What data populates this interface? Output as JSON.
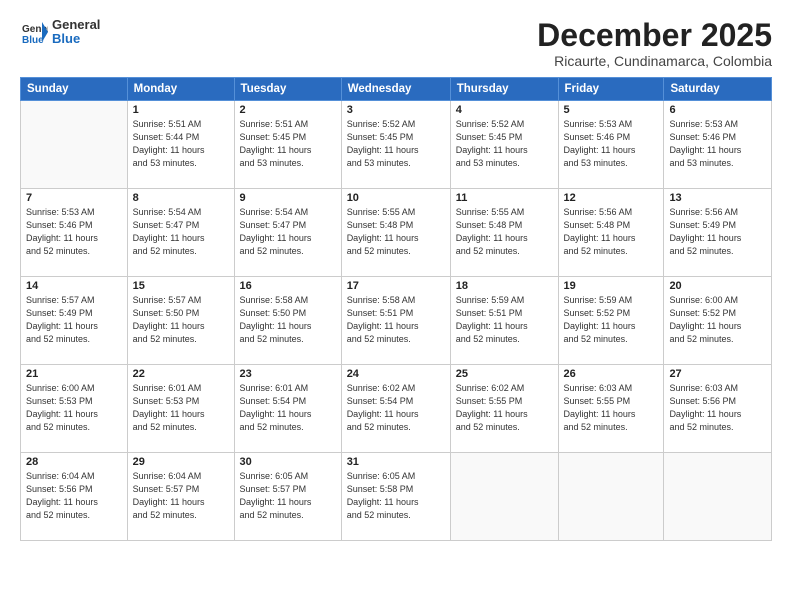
{
  "header": {
    "logo_general": "General",
    "logo_blue": "Blue",
    "main_title": "December 2025",
    "subtitle": "Ricaurte, Cundinamarca, Colombia"
  },
  "weekdays": [
    "Sunday",
    "Monday",
    "Tuesday",
    "Wednesday",
    "Thursday",
    "Friday",
    "Saturday"
  ],
  "weeks": [
    [
      {
        "day": "",
        "info": ""
      },
      {
        "day": "1",
        "info": "Sunrise: 5:51 AM\nSunset: 5:44 PM\nDaylight: 11 hours\nand 53 minutes."
      },
      {
        "day": "2",
        "info": "Sunrise: 5:51 AM\nSunset: 5:45 PM\nDaylight: 11 hours\nand 53 minutes."
      },
      {
        "day": "3",
        "info": "Sunrise: 5:52 AM\nSunset: 5:45 PM\nDaylight: 11 hours\nand 53 minutes."
      },
      {
        "day": "4",
        "info": "Sunrise: 5:52 AM\nSunset: 5:45 PM\nDaylight: 11 hours\nand 53 minutes."
      },
      {
        "day": "5",
        "info": "Sunrise: 5:53 AM\nSunset: 5:46 PM\nDaylight: 11 hours\nand 53 minutes."
      },
      {
        "day": "6",
        "info": "Sunrise: 5:53 AM\nSunset: 5:46 PM\nDaylight: 11 hours\nand 53 minutes."
      }
    ],
    [
      {
        "day": "7",
        "info": "Sunrise: 5:53 AM\nSunset: 5:46 PM\nDaylight: 11 hours\nand 52 minutes."
      },
      {
        "day": "8",
        "info": "Sunrise: 5:54 AM\nSunset: 5:47 PM\nDaylight: 11 hours\nand 52 minutes."
      },
      {
        "day": "9",
        "info": "Sunrise: 5:54 AM\nSunset: 5:47 PM\nDaylight: 11 hours\nand 52 minutes."
      },
      {
        "day": "10",
        "info": "Sunrise: 5:55 AM\nSunset: 5:48 PM\nDaylight: 11 hours\nand 52 minutes."
      },
      {
        "day": "11",
        "info": "Sunrise: 5:55 AM\nSunset: 5:48 PM\nDaylight: 11 hours\nand 52 minutes."
      },
      {
        "day": "12",
        "info": "Sunrise: 5:56 AM\nSunset: 5:48 PM\nDaylight: 11 hours\nand 52 minutes."
      },
      {
        "day": "13",
        "info": "Sunrise: 5:56 AM\nSunset: 5:49 PM\nDaylight: 11 hours\nand 52 minutes."
      }
    ],
    [
      {
        "day": "14",
        "info": "Sunrise: 5:57 AM\nSunset: 5:49 PM\nDaylight: 11 hours\nand 52 minutes."
      },
      {
        "day": "15",
        "info": "Sunrise: 5:57 AM\nSunset: 5:50 PM\nDaylight: 11 hours\nand 52 minutes."
      },
      {
        "day": "16",
        "info": "Sunrise: 5:58 AM\nSunset: 5:50 PM\nDaylight: 11 hours\nand 52 minutes."
      },
      {
        "day": "17",
        "info": "Sunrise: 5:58 AM\nSunset: 5:51 PM\nDaylight: 11 hours\nand 52 minutes."
      },
      {
        "day": "18",
        "info": "Sunrise: 5:59 AM\nSunset: 5:51 PM\nDaylight: 11 hours\nand 52 minutes."
      },
      {
        "day": "19",
        "info": "Sunrise: 5:59 AM\nSunset: 5:52 PM\nDaylight: 11 hours\nand 52 minutes."
      },
      {
        "day": "20",
        "info": "Sunrise: 6:00 AM\nSunset: 5:52 PM\nDaylight: 11 hours\nand 52 minutes."
      }
    ],
    [
      {
        "day": "21",
        "info": "Sunrise: 6:00 AM\nSunset: 5:53 PM\nDaylight: 11 hours\nand 52 minutes."
      },
      {
        "day": "22",
        "info": "Sunrise: 6:01 AM\nSunset: 5:53 PM\nDaylight: 11 hours\nand 52 minutes."
      },
      {
        "day": "23",
        "info": "Sunrise: 6:01 AM\nSunset: 5:54 PM\nDaylight: 11 hours\nand 52 minutes."
      },
      {
        "day": "24",
        "info": "Sunrise: 6:02 AM\nSunset: 5:54 PM\nDaylight: 11 hours\nand 52 minutes."
      },
      {
        "day": "25",
        "info": "Sunrise: 6:02 AM\nSunset: 5:55 PM\nDaylight: 11 hours\nand 52 minutes."
      },
      {
        "day": "26",
        "info": "Sunrise: 6:03 AM\nSunset: 5:55 PM\nDaylight: 11 hours\nand 52 minutes."
      },
      {
        "day": "27",
        "info": "Sunrise: 6:03 AM\nSunset: 5:56 PM\nDaylight: 11 hours\nand 52 minutes."
      }
    ],
    [
      {
        "day": "28",
        "info": "Sunrise: 6:04 AM\nSunset: 5:56 PM\nDaylight: 11 hours\nand 52 minutes."
      },
      {
        "day": "29",
        "info": "Sunrise: 6:04 AM\nSunset: 5:57 PM\nDaylight: 11 hours\nand 52 minutes."
      },
      {
        "day": "30",
        "info": "Sunrise: 6:05 AM\nSunset: 5:57 PM\nDaylight: 11 hours\nand 52 minutes."
      },
      {
        "day": "31",
        "info": "Sunrise: 6:05 AM\nSunset: 5:58 PM\nDaylight: 11 hours\nand 52 minutes."
      },
      {
        "day": "",
        "info": ""
      },
      {
        "day": "",
        "info": ""
      },
      {
        "day": "",
        "info": ""
      }
    ]
  ]
}
